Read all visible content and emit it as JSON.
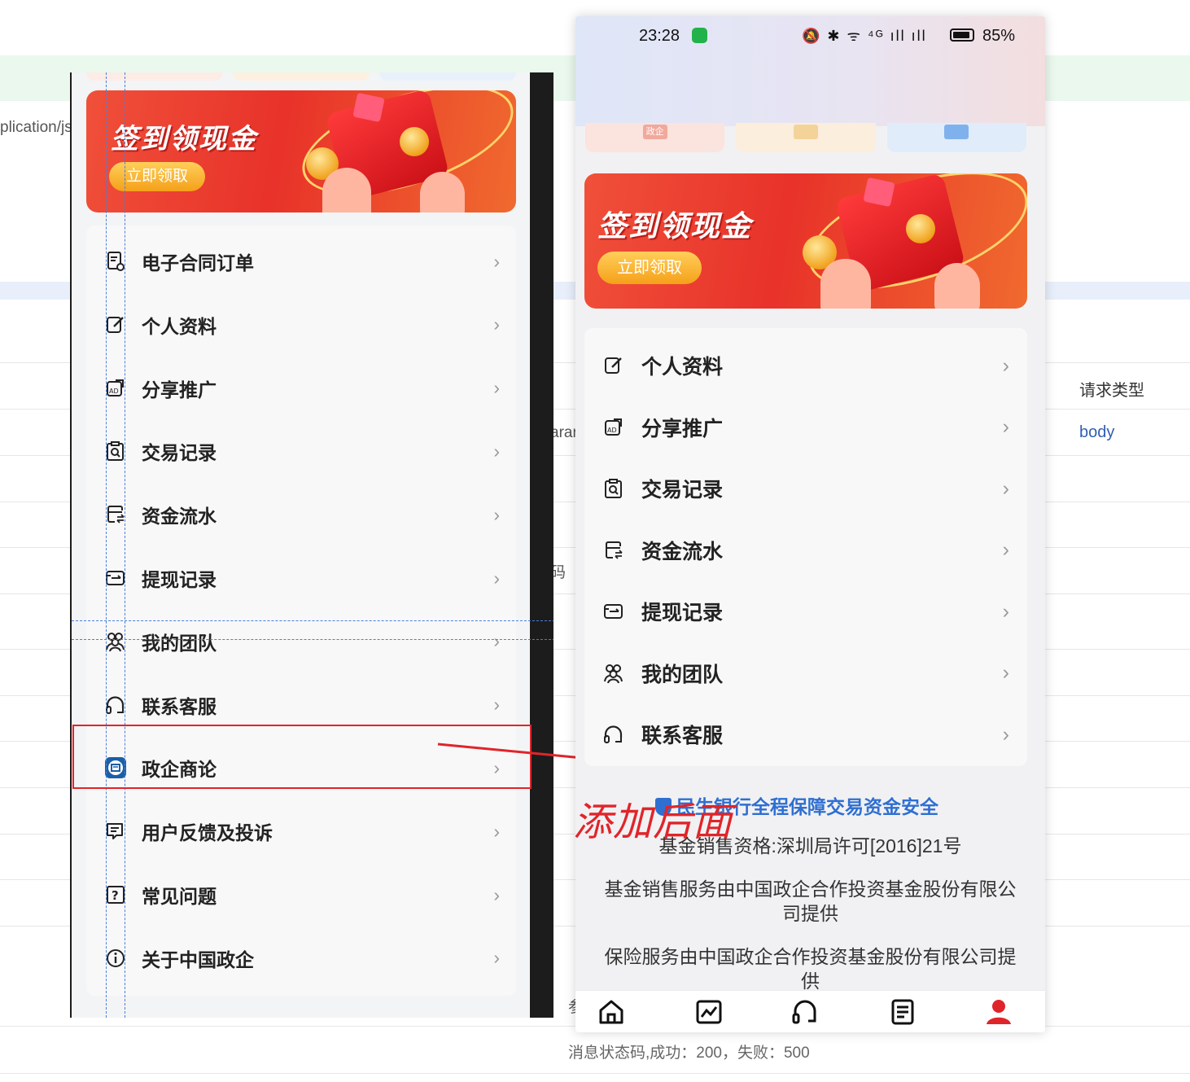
{
  "background_doc": {
    "url_fragment": "plication/js",
    "param_fragment": "arar",
    "code_fragment": "码",
    "ref_fragment": "参",
    "request_type_label": "请求类型",
    "body_link": "body",
    "status_note": "消息状态码,成功：200，失败：500"
  },
  "left_panel": {
    "banner": {
      "title": "签到领现金",
      "button": "立即领取"
    },
    "menu": [
      {
        "label": "电子合同订单",
        "icon": "contract-icon"
      },
      {
        "label": "个人资料",
        "icon": "edit-profile-icon"
      },
      {
        "label": "分享推广",
        "icon": "share-icon"
      },
      {
        "label": "交易记录",
        "icon": "transaction-icon"
      },
      {
        "label": "资金流水",
        "icon": "fund-flow-icon"
      },
      {
        "label": "提现记录",
        "icon": "withdraw-icon"
      },
      {
        "label": "我的团队",
        "icon": "team-icon"
      },
      {
        "label": "联系客服",
        "icon": "headset-icon"
      },
      {
        "label": "政企商论",
        "icon": "forum-icon"
      },
      {
        "label": "用户反馈及投诉",
        "icon": "feedback-icon"
      },
      {
        "label": "常见问题",
        "icon": "question-icon"
      },
      {
        "label": "关于中国政企",
        "icon": "info-icon"
      }
    ]
  },
  "annotation": {
    "note": "添加后面",
    "highlight_color": "#e0252a"
  },
  "phone": {
    "status_bar": {
      "time": "23:28",
      "icons": "🔕 ✱ ᯤ ⁴ᴳ ıll ıll",
      "battery": "85%"
    },
    "tab_chip_label": "政企",
    "banner": {
      "title": "签到领现金",
      "button": "立即领取"
    },
    "menu": [
      {
        "label": "个人资料",
        "icon": "edit-profile-icon"
      },
      {
        "label": "分享推广",
        "icon": "share-icon"
      },
      {
        "label": "交易记录",
        "icon": "transaction-icon"
      },
      {
        "label": "资金流水",
        "icon": "fund-flow-icon"
      },
      {
        "label": "提现记录",
        "icon": "withdraw-icon"
      },
      {
        "label": "我的团队",
        "icon": "team-icon"
      },
      {
        "label": "联系客服",
        "icon": "headset-icon"
      }
    ],
    "security_text": "民生银行全程保障交易资金安全",
    "license_text": "基金销售资格:深圳局许可[2016]21号",
    "fund_service_text": "基金销售服务由中国政企合作投资基金股份有限公司提供",
    "insurance_text": "保险服务由中国政企合作投资基金股份有限公司提供",
    "tabbar": [
      {
        "name": "home-icon"
      },
      {
        "name": "market-icon"
      },
      {
        "name": "service-icon"
      },
      {
        "name": "orders-icon"
      },
      {
        "name": "profile-icon",
        "active": true
      }
    ],
    "accent": "#e0252a",
    "link_color": "#2f6fd1"
  }
}
